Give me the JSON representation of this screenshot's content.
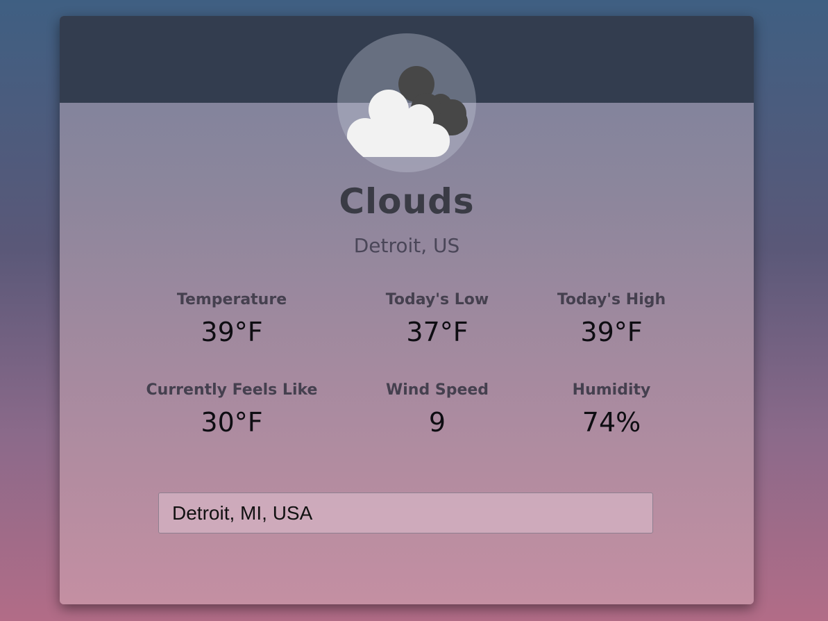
{
  "weather": {
    "condition": "Clouds",
    "location": "Detroit, US",
    "icon": "clouds-icon"
  },
  "stats": {
    "temperature": {
      "label": "Temperature",
      "value": "39°F"
    },
    "low": {
      "label": "Today's Low",
      "value": "37°F"
    },
    "high": {
      "label": "Today's High",
      "value": "39°F"
    },
    "feels_like": {
      "label": "Currently Feels Like",
      "value": "30°F"
    },
    "wind": {
      "label": "Wind Speed",
      "value": "9"
    },
    "humidity": {
      "label": "Humidity",
      "value": "74%"
    }
  },
  "search": {
    "value": "Detroit, MI, USA"
  },
  "colors": {
    "header": "#333d4f",
    "title": "#3a3b45",
    "cloud_front": "#f2f2f2",
    "cloud_back": "#474747"
  }
}
